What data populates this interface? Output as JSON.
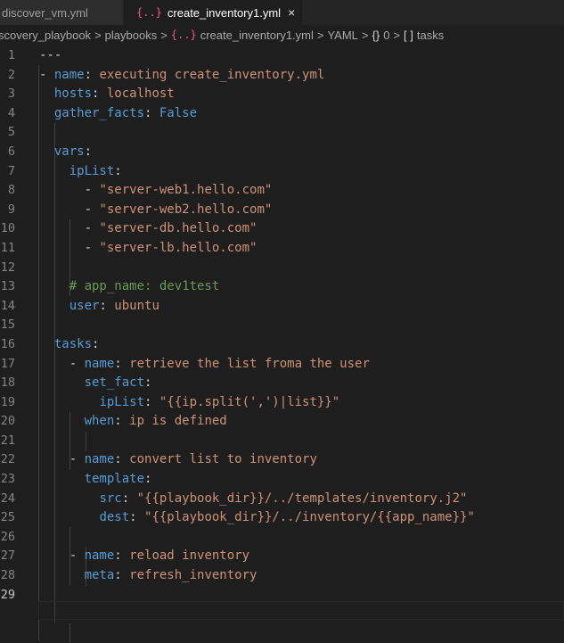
{
  "tabs": [
    {
      "label": "discover_vm.yml",
      "active": false
    },
    {
      "label": "create_inventory1.yml",
      "active": true,
      "icon": "{..}",
      "close": "×"
    }
  ],
  "breadcrumb": {
    "items": [
      "scovery_playbook",
      "playbooks",
      "create_inventory1.yml",
      "YAML",
      "0",
      "tasks"
    ],
    "file_icon": "{..}",
    "object_icon": "{}",
    "array_icon": "[ ]",
    "separator": ">"
  },
  "editor": {
    "line_numbers": [
      "1",
      "2",
      "3",
      "4",
      "5",
      "6",
      "7",
      "8",
      "9",
      "10",
      "11",
      "12",
      "13",
      "14",
      "15",
      "16",
      "17",
      "18",
      "19",
      "20",
      "21",
      "22",
      "23",
      "24",
      "25",
      "26",
      "27",
      "28",
      "29"
    ],
    "lines": [
      [
        {
          "t": "---",
          "c": "p"
        }
      ],
      [
        {
          "t": "- ",
          "c": "p"
        },
        {
          "t": "name",
          "c": "k"
        },
        {
          "t": ": ",
          "c": "p"
        },
        {
          "t": "executing create_inventory.yml",
          "c": "s"
        }
      ],
      [
        {
          "t": "  ",
          "c": "p"
        },
        {
          "t": "hosts",
          "c": "k"
        },
        {
          "t": ": ",
          "c": "p"
        },
        {
          "t": "localhost",
          "c": "s"
        }
      ],
      [
        {
          "t": "  ",
          "c": "p"
        },
        {
          "t": "gather_facts",
          "c": "k"
        },
        {
          "t": ": ",
          "c": "p"
        },
        {
          "t": "False",
          "c": "b"
        }
      ],
      [],
      [
        {
          "t": "  ",
          "c": "p"
        },
        {
          "t": "vars",
          "c": "k"
        },
        {
          "t": ":",
          "c": "p"
        }
      ],
      [
        {
          "t": "    ",
          "c": "p"
        },
        {
          "t": "ipList",
          "c": "k"
        },
        {
          "t": ":",
          "c": "p"
        }
      ],
      [
        {
          "t": "      - ",
          "c": "p"
        },
        {
          "t": "\"server-web1.hello.com\"",
          "c": "s"
        }
      ],
      [
        {
          "t": "      - ",
          "c": "p"
        },
        {
          "t": "\"server-web2.hello.com\"",
          "c": "s"
        }
      ],
      [
        {
          "t": "      - ",
          "c": "p"
        },
        {
          "t": "\"server-db.hello.com\"",
          "c": "s"
        }
      ],
      [
        {
          "t": "      - ",
          "c": "p"
        },
        {
          "t": "\"server-lb.hello.com\"",
          "c": "s"
        }
      ],
      [],
      [
        {
          "t": "    ",
          "c": "p"
        },
        {
          "t": "# app_name: dev1test",
          "c": "c"
        }
      ],
      [
        {
          "t": "    ",
          "c": "p"
        },
        {
          "t": "user",
          "c": "k"
        },
        {
          "t": ": ",
          "c": "p"
        },
        {
          "t": "ubuntu",
          "c": "s"
        }
      ],
      [],
      [
        {
          "t": "  ",
          "c": "p"
        },
        {
          "t": "tasks",
          "c": "k"
        },
        {
          "t": ":",
          "c": "p"
        }
      ],
      [
        {
          "t": "    - ",
          "c": "p"
        },
        {
          "t": "name",
          "c": "k"
        },
        {
          "t": ": ",
          "c": "p"
        },
        {
          "t": "retrieve the list froma the user",
          "c": "s"
        }
      ],
      [
        {
          "t": "      ",
          "c": "p"
        },
        {
          "t": "set_fact",
          "c": "k"
        },
        {
          "t": ":",
          "c": "p"
        }
      ],
      [
        {
          "t": "        ",
          "c": "p"
        },
        {
          "t": "ipList",
          "c": "k"
        },
        {
          "t": ": ",
          "c": "p"
        },
        {
          "t": "\"{{ip.split(',')|list}}\"",
          "c": "s"
        }
      ],
      [
        {
          "t": "      ",
          "c": "p"
        },
        {
          "t": "when",
          "c": "k"
        },
        {
          "t": ": ",
          "c": "p"
        },
        {
          "t": "ip is defined",
          "c": "s"
        }
      ],
      [],
      [
        {
          "t": "    - ",
          "c": "p"
        },
        {
          "t": "name",
          "c": "k"
        },
        {
          "t": ": ",
          "c": "p"
        },
        {
          "t": "convert list to inventory",
          "c": "s"
        }
      ],
      [
        {
          "t": "      ",
          "c": "p"
        },
        {
          "t": "template",
          "c": "k"
        },
        {
          "t": ":",
          "c": "p"
        }
      ],
      [
        {
          "t": "        ",
          "c": "p"
        },
        {
          "t": "src",
          "c": "k"
        },
        {
          "t": ": ",
          "c": "p"
        },
        {
          "t": "\"{{playbook_dir}}/../templates/inventory.j2\"",
          "c": "s"
        }
      ],
      [
        {
          "t": "        ",
          "c": "p"
        },
        {
          "t": "dest",
          "c": "k"
        },
        {
          "t": ": ",
          "c": "p"
        },
        {
          "t": "\"{{playbook_dir}}/../inventory/{{app_name}}\"",
          "c": "s"
        }
      ],
      [],
      [
        {
          "t": "    - ",
          "c": "p"
        },
        {
          "t": "name",
          "c": "k"
        },
        {
          "t": ": ",
          "c": "p"
        },
        {
          "t": "reload inventory",
          "c": "s"
        }
      ],
      [
        {
          "t": "      ",
          "c": "p"
        },
        {
          "t": "meta",
          "c": "k"
        },
        {
          "t": ": ",
          "c": "p"
        },
        {
          "t": "refresh_inventory",
          "c": "s"
        }
      ],
      []
    ]
  },
  "colors": {
    "background": "#1e1e1e",
    "key": "#569cd6",
    "string": "#ce9178",
    "comment": "#6a9955",
    "line_number": "#858585"
  }
}
